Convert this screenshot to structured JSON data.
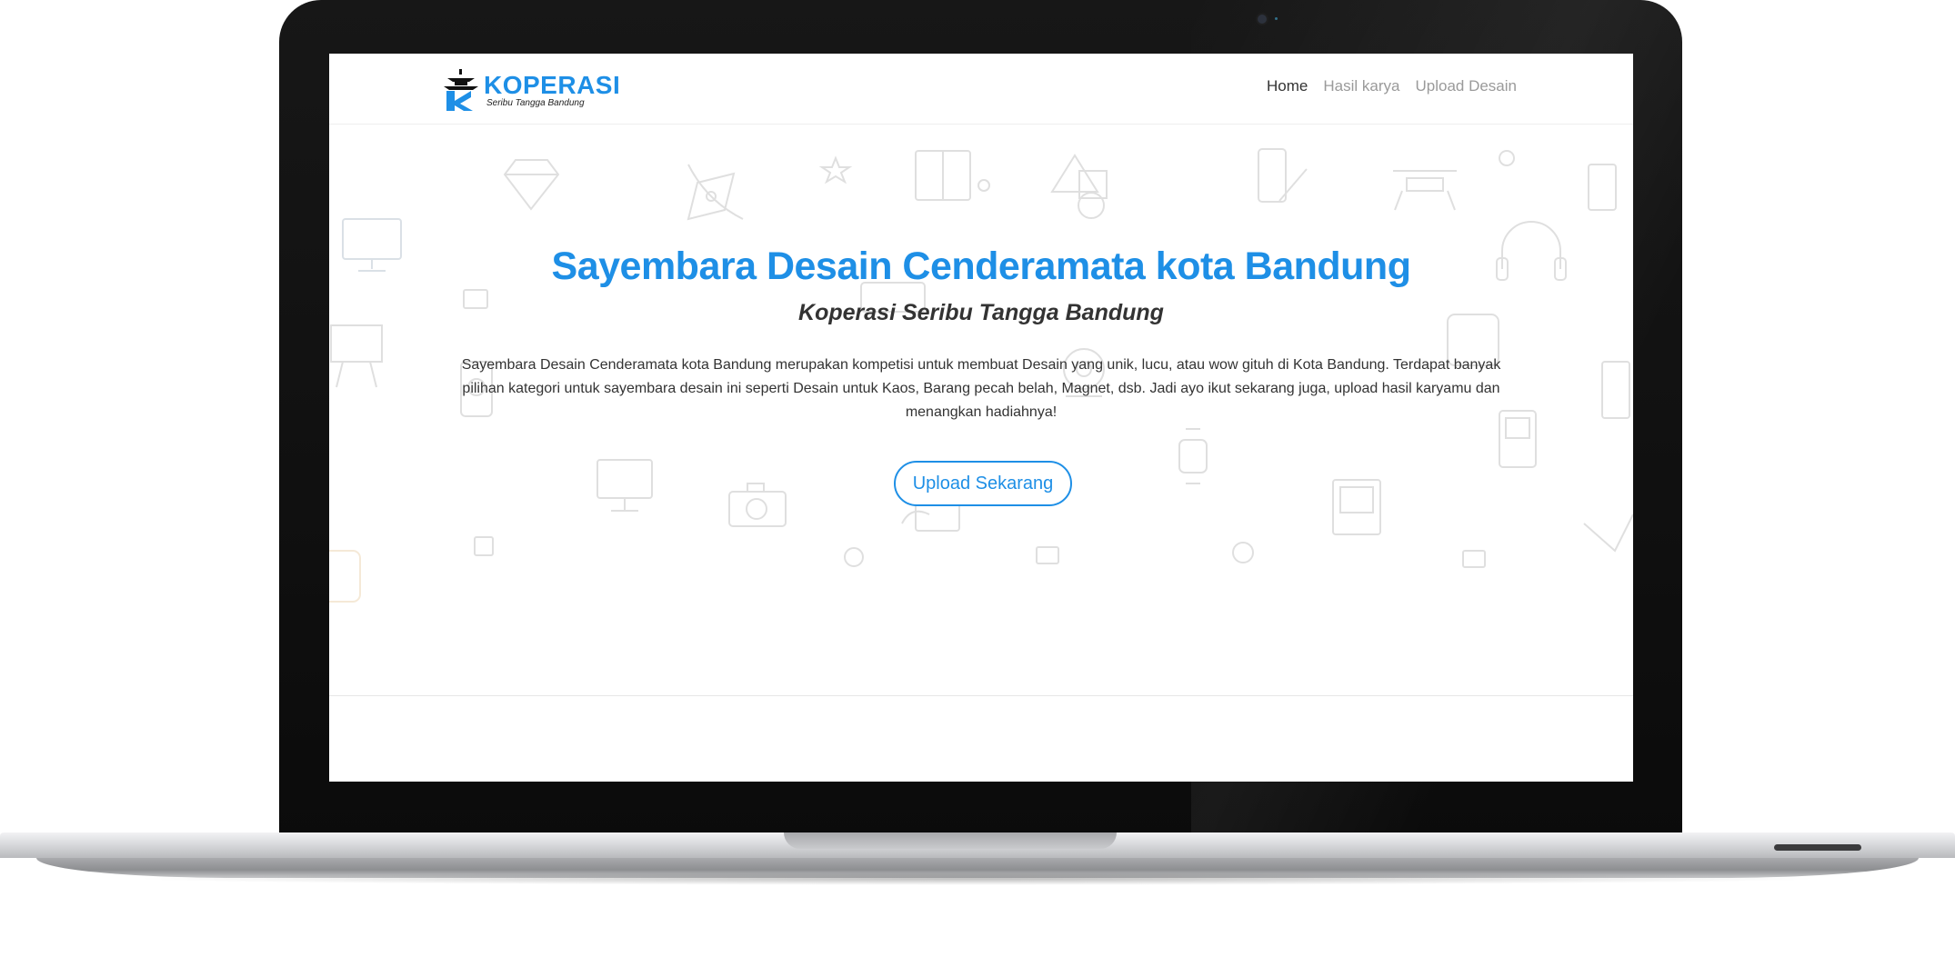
{
  "navbar": {
    "logo": {
      "title": "KOPERASI",
      "subtitle": "Seribu Tangga Bandung"
    },
    "links": [
      {
        "label": "Home",
        "active": true
      },
      {
        "label": "Hasil karya",
        "active": false
      },
      {
        "label": "Upload Desain",
        "active": false
      }
    ]
  },
  "hero": {
    "title": "Sayembara Desain Cenderamata kota Bandung",
    "subtitle": "Koperasi Seribu Tangga Bandung",
    "description": "Sayembara Desain Cenderamata kota Bandung merupakan kompetisi untuk membuat Desain yang unik, lucu, atau wow gituh di Kota Bandung. Terdapat banyak pilihan kategori untuk sayembara desain ini seperti Desain untuk Kaos, Barang pecah belah, Magnet, dsb. Jadi ayo ikut sekarang juga, upload hasil karyamu dan menangkan hadiahnya!",
    "cta_label": "Upload Sekarang",
    "background_icons": [
      "diamond-icon",
      "pen-tool-icon",
      "star-icon",
      "book-icon",
      "shapes-icon",
      "phone-edit-icon",
      "drone-icon",
      "headphones-icon",
      "monitor-icon",
      "photoshop-icon",
      "easel-icon",
      "phone-icon",
      "webcam-icon",
      "computer-icon",
      "camera-icon",
      "book-hand-icon",
      "watch-icon",
      "gameboy-icon",
      "illustrator-icon",
      "retro-computer-icon"
    ]
  },
  "colors": {
    "accent": "#1e8fe6",
    "text": "#333333",
    "nav_inactive": "#9a9a9a"
  }
}
